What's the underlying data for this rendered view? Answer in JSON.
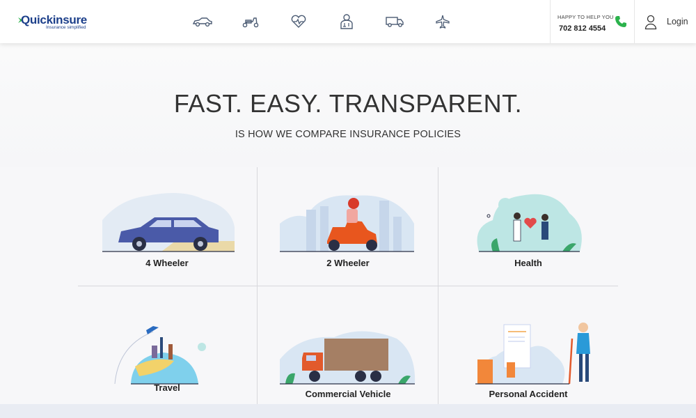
{
  "header": {
    "brand": "Quickinsure",
    "tagline": "Insurance simplified",
    "nav_icons": [
      "car-icon",
      "scooter-icon",
      "heart-pulse-icon",
      "doctor-icon",
      "truck-icon",
      "airplane-icon"
    ],
    "help_text": "HAPPY TO HELP YOU",
    "phone": "702 812 4554",
    "login_label": "Login"
  },
  "hero": {
    "headline": "FAST. EASY. TRANSPARENT.",
    "subhead": "IS HOW WE COMPARE INSURANCE POLICIES"
  },
  "products": [
    {
      "label": "4 Wheeler"
    },
    {
      "label": "2 Wheeler"
    },
    {
      "label": "Health"
    },
    {
      "label": "Travel"
    },
    {
      "label": "Commercial Vehicle"
    },
    {
      "label": "Personal Accident"
    }
  ],
  "colors": {
    "brand_blue": "#1c3f8a",
    "accent_green": "#2bb24c",
    "car_blue": "#4a5aa8",
    "scooter_orange": "#e8561e",
    "truck_orange": "#e25a2c",
    "illustration_teal": "#bde6e4"
  }
}
